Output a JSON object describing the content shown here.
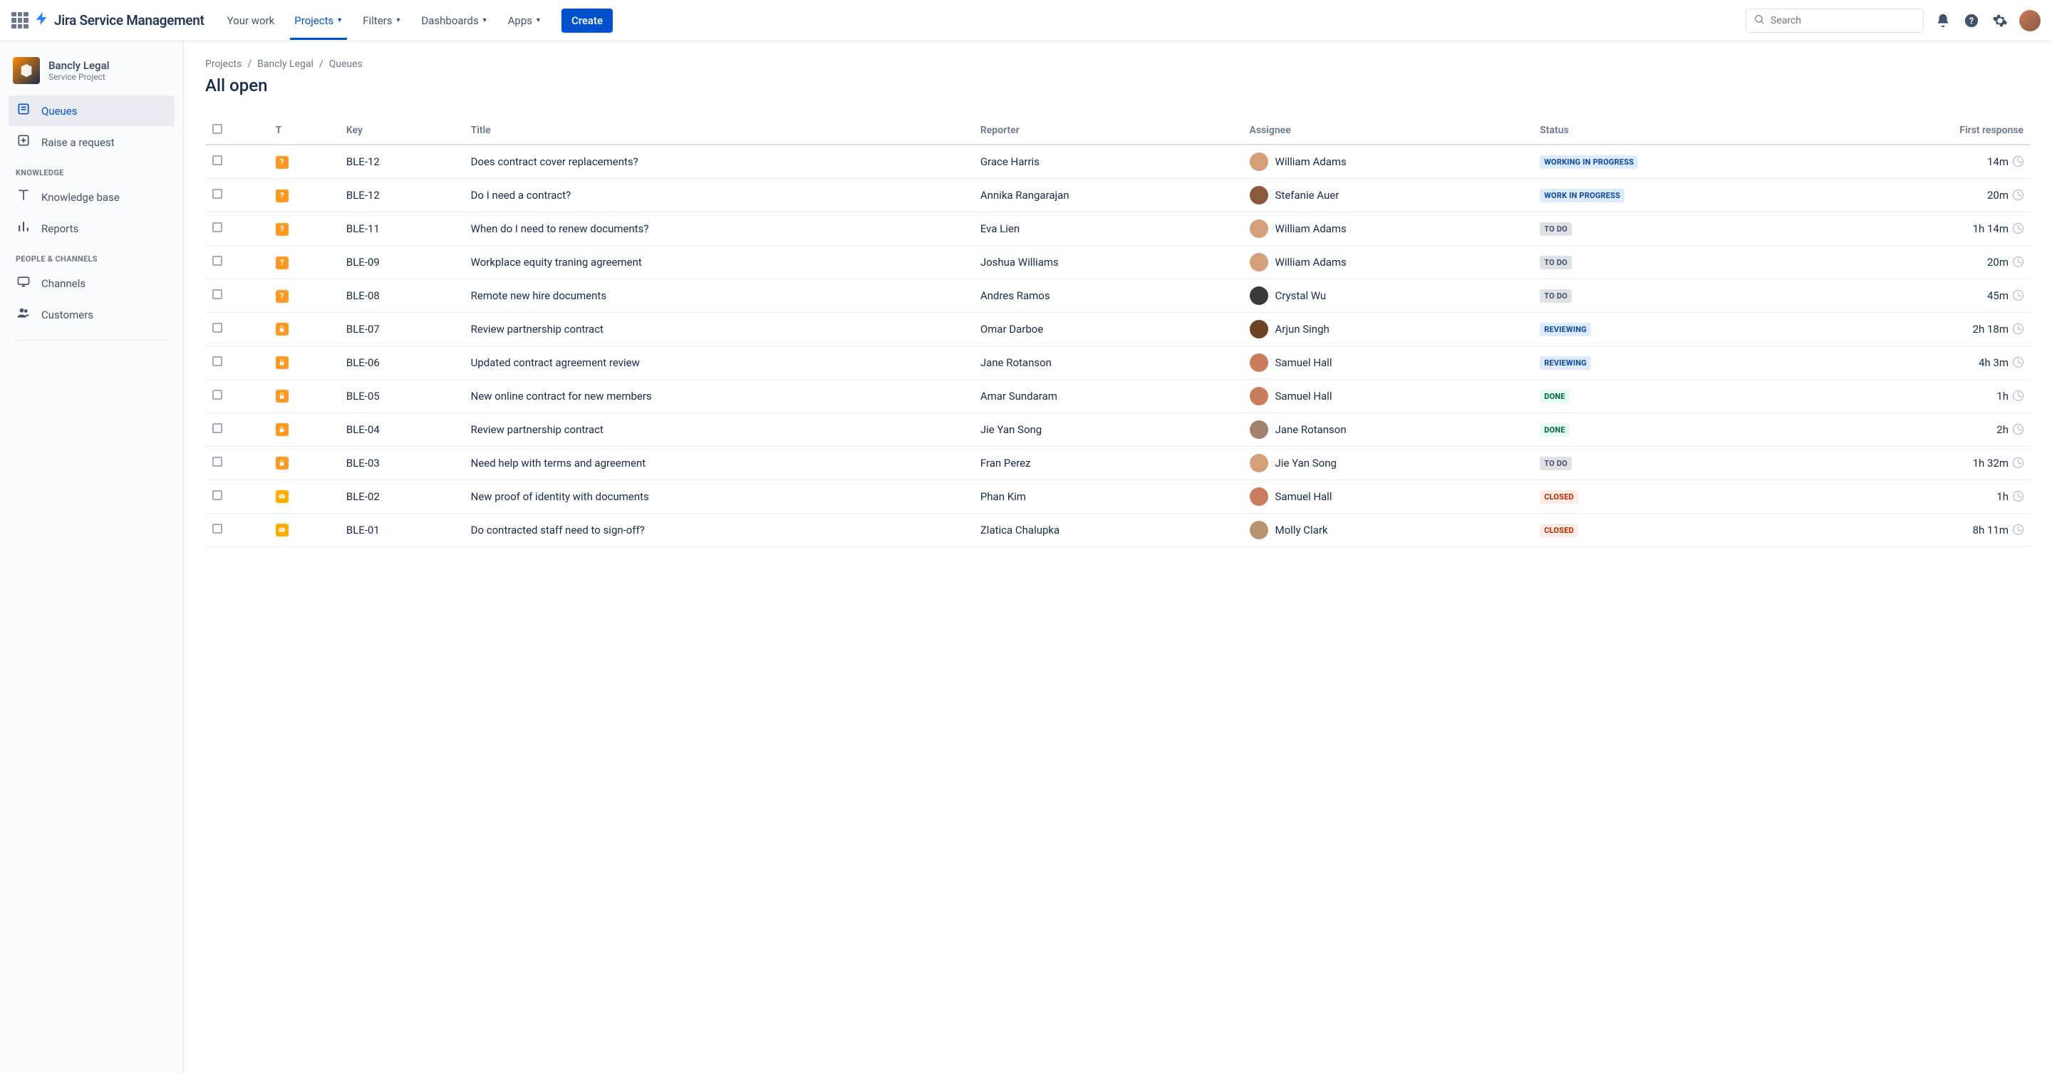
{
  "header": {
    "product": "Jira Service Management",
    "nav": [
      "Your work",
      "Projects",
      "Filters",
      "Dashboards",
      "Apps"
    ],
    "navDropdown": [
      false,
      true,
      true,
      true,
      true
    ],
    "activeNav": 1,
    "createLabel": "Create",
    "searchPlaceholder": "Search"
  },
  "project": {
    "name": "Bancly Legal",
    "sub": "Service Project"
  },
  "sidebar": {
    "primary": [
      {
        "icon": "queue",
        "label": "Queues",
        "active": true
      },
      {
        "icon": "raise",
        "label": "Raise a request"
      }
    ],
    "sections": [
      {
        "title": "KNOWLEDGE",
        "items": [
          {
            "icon": "kb",
            "label": "Knowledge base"
          },
          {
            "icon": "reports",
            "label": "Reports"
          }
        ]
      },
      {
        "title": "PEOPLE & CHANNELS",
        "items": [
          {
            "icon": "channels",
            "label": "Channels"
          },
          {
            "icon": "customers",
            "label": "Customers"
          }
        ]
      }
    ]
  },
  "breadcrumbs": [
    "Projects",
    "Bancly Legal",
    "Queues"
  ],
  "pageTitle": "All open",
  "table": {
    "columns": [
      "",
      "T",
      "Key",
      "Title",
      "Reporter",
      "Assignee",
      "Status",
      "First response"
    ],
    "rows": [
      {
        "type": "question",
        "key": "BLE-12",
        "title": "Does contract cover replacements?",
        "reporter": "Grace Harris",
        "assignee": "William Adams",
        "avColor": "#d4a07a",
        "status": "WORKING IN PROGRESS",
        "statusClass": "st-wip",
        "resp": "14m"
      },
      {
        "type": "question",
        "key": "BLE-12",
        "title": "Do I need a contract?",
        "reporter": "Annika Rangarajan",
        "assignee": "Stefanie Auer",
        "avColor": "#8b5a3c",
        "status": "WORK IN PROGRESS",
        "statusClass": "st-wip",
        "resp": "20m"
      },
      {
        "type": "question",
        "key": "BLE-11",
        "title": "When do I need to renew documents?",
        "reporter": "Eva Lien",
        "assignee": "William Adams",
        "avColor": "#d4a07a",
        "status": "TO DO",
        "statusClass": "st-todo",
        "resp": "1h 14m"
      },
      {
        "type": "question",
        "key": "BLE-09",
        "title": "Workplace equity traning agreement",
        "reporter": "Joshua Williams",
        "assignee": "William Adams",
        "avColor": "#d4a07a",
        "status": "TO DO",
        "statusClass": "st-todo",
        "resp": "20m"
      },
      {
        "type": "question",
        "key": "BLE-08",
        "title": "Remote new hire documents",
        "reporter": "Andres Ramos",
        "assignee": "Crystal Wu",
        "avColor": "#3a3a3a",
        "status": "TO DO",
        "statusClass": "st-todo",
        "resp": "45m"
      },
      {
        "type": "lock",
        "key": "BLE-07",
        "title": "Review partnership contract",
        "reporter": "Omar Darboe",
        "assignee": "Arjun Singh",
        "avColor": "#6b4226",
        "status": "REVIEWING",
        "statusClass": "st-rev",
        "resp": "2h 18m"
      },
      {
        "type": "lock",
        "key": "BLE-06",
        "title": "Updated contract agreement review",
        "reporter": "Jane Rotanson",
        "assignee": "Samuel Hall",
        "avColor": "#c97d5d",
        "status": "REVIEWING",
        "statusClass": "st-rev",
        "resp": "4h 3m"
      },
      {
        "type": "lock",
        "key": "BLE-05",
        "title": "New online contract for new members",
        "reporter": "Amar Sundaram",
        "assignee": "Samuel Hall",
        "avColor": "#c97d5d",
        "status": "DONE",
        "statusClass": "st-done",
        "resp": "1h"
      },
      {
        "type": "lock",
        "key": "BLE-04",
        "title": "Review partnership contract",
        "reporter": "Jie Yan Song",
        "assignee": "Jane Rotanson",
        "avColor": "#a0826d",
        "status": "DONE",
        "statusClass": "st-done",
        "resp": "2h"
      },
      {
        "type": "lock",
        "key": "BLE-03",
        "title": "Need help with terms and agreement",
        "reporter": "Fran Perez",
        "assignee": "Jie Yan Song",
        "avColor": "#d4a07a",
        "status": "TO DO",
        "statusClass": "st-todo",
        "resp": "1h 32m"
      },
      {
        "type": "mail",
        "key": "BLE-02",
        "title": "New proof of identity with documents",
        "reporter": "Phan Kim",
        "assignee": "Samuel Hall",
        "avColor": "#c97d5d",
        "status": "CLOSED",
        "statusClass": "st-closed",
        "resp": "1h"
      },
      {
        "type": "mail",
        "key": "BLE-01",
        "title": "Do contracted staff need to sign-off?",
        "reporter": "Zlatica Chalupka",
        "assignee": "Molly Clark",
        "avColor": "#b8956f",
        "status": "CLOSED",
        "statusClass": "st-closed",
        "resp": "8h 11m"
      }
    ]
  }
}
